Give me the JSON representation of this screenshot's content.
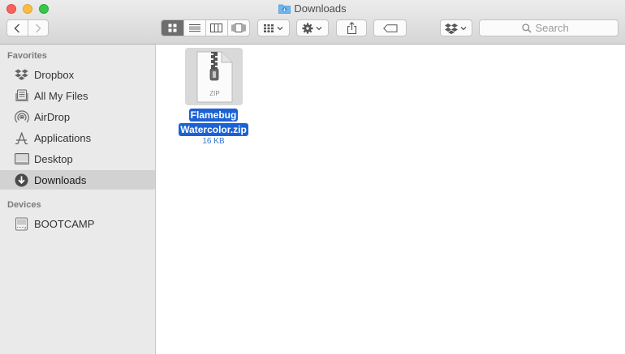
{
  "window": {
    "title": "Downloads",
    "title_icon": "folder-downloads-icon"
  },
  "toolbar": {
    "back_icon": "chevron-left-icon",
    "forward_icon": "chevron-right-icon",
    "views": [
      "icon-view-icon",
      "list-view-icon",
      "column-view-icon",
      "cover-flow-view-icon"
    ],
    "active_view": "icon-view",
    "arrange_icon": "arrange-grid-icon",
    "action_icon": "gear-icon",
    "share_icon": "share-icon",
    "tag_icon": "tag-icon",
    "dropbox_icon": "dropbox-icon",
    "search": {
      "placeholder": "Search",
      "value": ""
    }
  },
  "sidebar": {
    "favorites_header": "Favorites",
    "favorites": [
      {
        "label": "Dropbox",
        "icon": "dropbox-icon"
      },
      {
        "label": "All My Files",
        "icon": "all-files-icon"
      },
      {
        "label": "AirDrop",
        "icon": "airdrop-icon"
      },
      {
        "label": "Applications",
        "icon": "applications-icon"
      },
      {
        "label": "Desktop",
        "icon": "desktop-icon"
      },
      {
        "label": "Downloads",
        "icon": "downloads-icon",
        "selected": true
      }
    ],
    "devices_header": "Devices",
    "devices": [
      {
        "label": "BOOTCAMP",
        "icon": "hard-drive-icon"
      }
    ]
  },
  "files": [
    {
      "name_line1": "Flamebug",
      "name_line2": "Watercolor.zip",
      "size": "16 KB",
      "badge": "ZIP",
      "icon": "zip-file-icon",
      "selected": true
    }
  ],
  "colors": {
    "selection": "#1c62d4",
    "size_text": "#3a74c9",
    "sidebar_bg": "#eaeaea",
    "sidebar_selected": "#d2d2d2"
  }
}
